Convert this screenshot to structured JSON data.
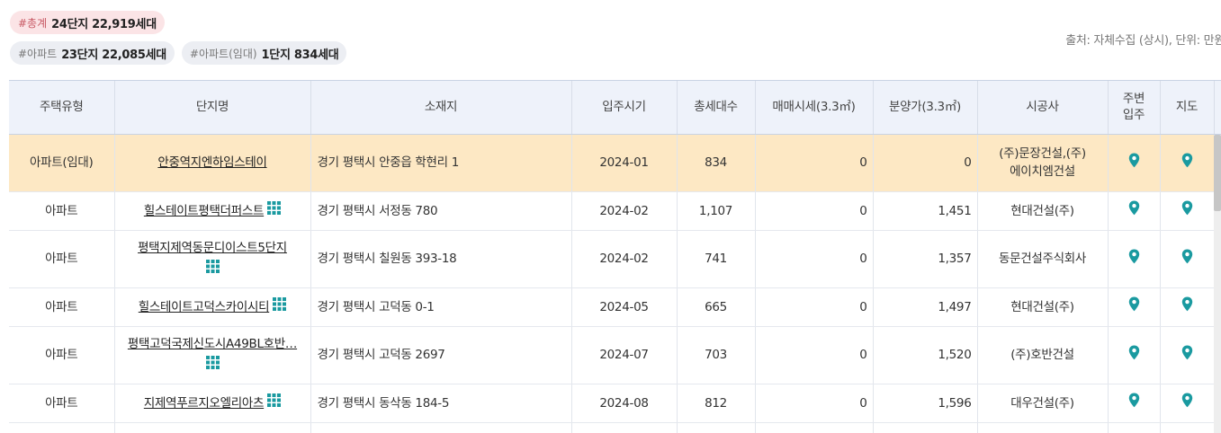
{
  "summary": {
    "total": {
      "tag": "#총계",
      "value": "24단지 22,919세대"
    },
    "apartment": {
      "tag": "#아파트",
      "value": "23단지 22,085세대"
    },
    "rental": {
      "tag": "#아파트(임대)",
      "value": "1단지 834세대"
    }
  },
  "source_note": "출처: 자체수집 (상시), 단위: 만원",
  "table": {
    "headers": {
      "type": "주택유형",
      "name": "단지명",
      "address": "소재지",
      "move_in": "입주시기",
      "units": "총세대수",
      "sale_price": "매매시세(3.3㎡)",
      "presale_price": "분양가(3.3㎡)",
      "builder": "시공사",
      "nearby_1": "주변",
      "nearby_2": "입주",
      "map": "지도"
    },
    "rows": [
      {
        "type": "아파트(임대)",
        "name": "안중역지엔하임스테이",
        "address": "경기 평택시 안중읍 학현리 1",
        "move_in": "2024-01",
        "units": "834",
        "sale_price": "0",
        "presale_price": "0",
        "builder_1": "(주)문장건설,(주)",
        "builder_2": "에이치엠건설"
      },
      {
        "type": "아파트",
        "name": "힐스테이트평택더퍼스트",
        "address": "경기 평택시 서정동 780",
        "move_in": "2024-02",
        "units": "1,107",
        "sale_price": "0",
        "presale_price": "1,451",
        "builder_1": "현대건설(주)",
        "builder_2": ""
      },
      {
        "type": "아파트",
        "name": "평택지제역동문디이스트5단지",
        "address": "경기 평택시 칠원동 393-18",
        "move_in": "2024-02",
        "units": "741",
        "sale_price": "0",
        "presale_price": "1,357",
        "builder_1": "동문건설주식회사",
        "builder_2": ""
      },
      {
        "type": "아파트",
        "name": "힐스테이트고덕스카이시티",
        "address": "경기 평택시 고덕동 0-1",
        "move_in": "2024-05",
        "units": "665",
        "sale_price": "0",
        "presale_price": "1,497",
        "builder_1": "현대건설(주)",
        "builder_2": ""
      },
      {
        "type": "아파트",
        "name": "평택고덕국제신도시A49BL호반…",
        "address": "경기 평택시 고덕동 2697",
        "move_in": "2024-07",
        "units": "703",
        "sale_price": "0",
        "presale_price": "1,520",
        "builder_1": "(주)호반건설",
        "builder_2": ""
      },
      {
        "type": "아파트",
        "name": "지제역푸르지오엘리아츠",
        "address": "경기 평택시 동삭동 184-5",
        "move_in": "2024-08",
        "units": "812",
        "sale_price": "0",
        "presale_price": "1,596",
        "builder_1": "대우건설(주)",
        "builder_2": ""
      },
      {
        "type": "",
        "name": "",
        "address": "",
        "move_in": "",
        "units": "",
        "sale_price": "",
        "presale_price": "",
        "builder_1": "",
        "builder_2": ""
      }
    ]
  },
  "colors": {
    "accent_teal": "#1a9aa0",
    "highlight_row": "#fde8c4",
    "header_bg": "#eef2fa"
  },
  "icons": {
    "complex_info": "grid-icon",
    "nearby": "map-pin-icon",
    "map": "map-pin-icon"
  }
}
